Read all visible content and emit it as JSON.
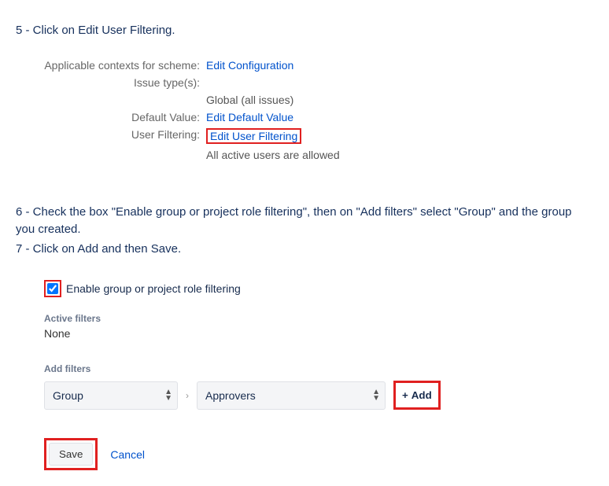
{
  "steps": {
    "s5": "5 - Click on Edit User Filtering.",
    "s6": "6 - Check the box \"Enable group or project role filtering\", then on \"Add filters\" select \"Group\" and the group you created.",
    "s7": "7 - Click on Add and then Save."
  },
  "scheme": {
    "contexts_label": "Applicable contexts for scheme:",
    "edit_config": "Edit Configuration",
    "issue_types_label": "Issue type(s):",
    "issue_types_value": "Global (all issues)",
    "default_label": "Default Value:",
    "edit_default": "Edit Default Value",
    "filtering_label": "User Filtering:",
    "edit_filtering": "Edit User Filtering",
    "filtering_note": "All active users are allowed"
  },
  "filter_panel": {
    "enable_label": "Enable group or project role filtering",
    "active_heading": "Active filters",
    "none": "None",
    "add_heading": "Add filters",
    "select1": "Group",
    "select2": "Approvers",
    "add_btn": "Add",
    "save": "Save",
    "cancel": "Cancel"
  }
}
